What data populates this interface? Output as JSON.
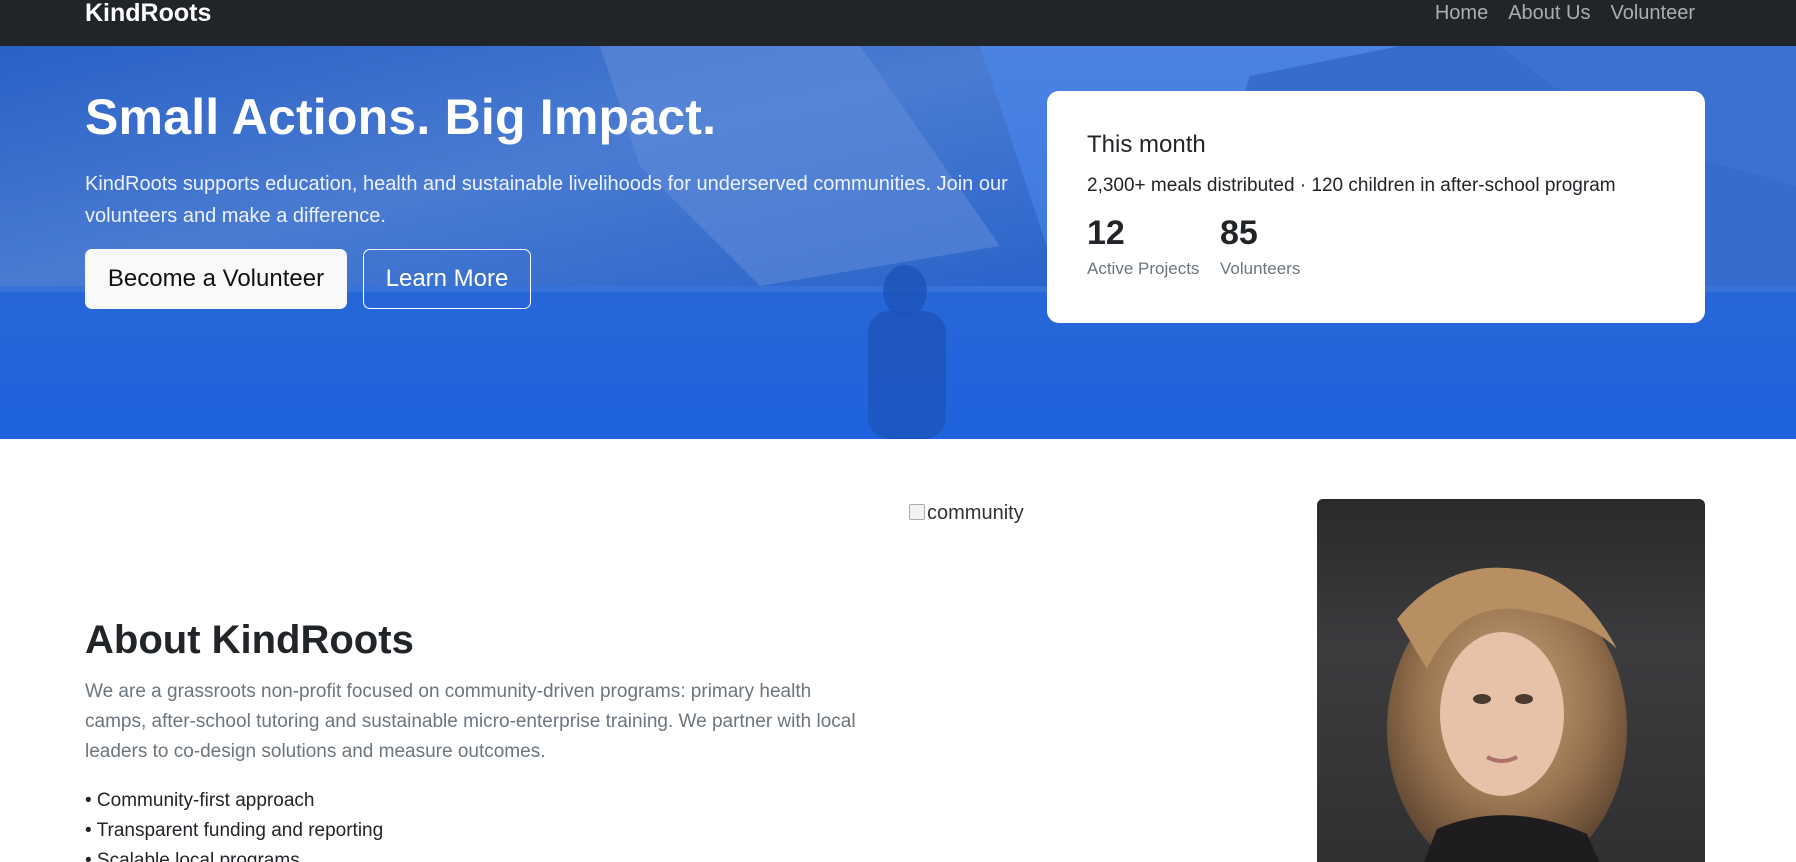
{
  "navbar": {
    "brand": "KindRoots",
    "links": [
      "Home",
      "About Us",
      "Volunteer"
    ]
  },
  "hero": {
    "title": "Small Actions. Big Impact.",
    "description": "KindRoots supports education, health and sustainable livelihoods for underserved communities. Join our volunteers and make a difference.",
    "primary_button": "Become a Volunteer",
    "secondary_button": "Learn More"
  },
  "stats_card": {
    "title": "This month",
    "subtitle": "2,300+ meals distributed · 120 children in after-school program",
    "stats": [
      {
        "value": "12",
        "label": "Active Projects"
      },
      {
        "value": "85",
        "label": "Volunteers"
      }
    ]
  },
  "about": {
    "title": "About KindRoots",
    "text": "We are a grassroots non-profit focused on community-driven programs: primary health camps, after-school tutoring and sustainable micro-enterprise training. We partner with local leaders to co-design solutions and measure outcomes.",
    "bullets": [
      "• Community-first approach",
      "• Transparent funding and reporting",
      "• Scalable local programs"
    ],
    "image_alt": "community"
  },
  "colors": {
    "navbar_bg": "#212529",
    "hero_blue": "#1f62d8",
    "muted_text": "#6c757d"
  }
}
